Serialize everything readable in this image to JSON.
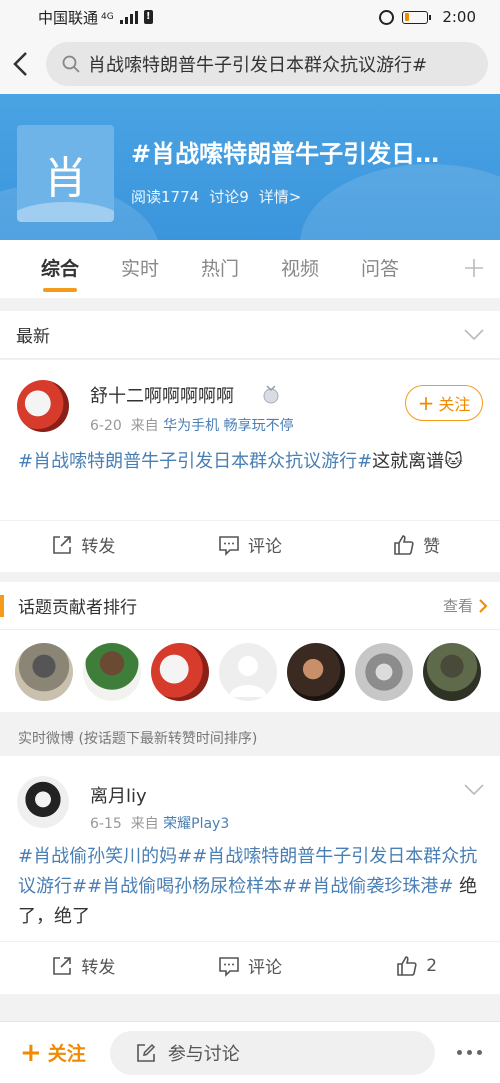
{
  "status_bar": {
    "carrier": "中国联通",
    "network": "4G",
    "time": "2:00"
  },
  "search": {
    "query": "肖战嗦特朗普牛子引发日本群众抗议游行#"
  },
  "topic": {
    "thumb_char": "肖",
    "title": "#肖战嗦特朗普牛子引发日…",
    "reads": "阅读1774",
    "discussions": "讨论9",
    "details": "详情>"
  },
  "tabs": [
    "综合",
    "实时",
    "热门",
    "视频",
    "问答"
  ],
  "latest_section": {
    "title": "最新"
  },
  "post1": {
    "username": "舒十二啊啊啊啊啊",
    "date": "6-20",
    "from": "来自",
    "source": "华为手机 畅享玩不停",
    "follow_label": "关注",
    "hashtag": "#肖战嗦特朗普牛子引发日本群众抗议游行#",
    "text": "这就离谱",
    "emoji": "🐱",
    "actions": {
      "repost": "转发",
      "comment": "评论",
      "like": "赞"
    }
  },
  "contributors": {
    "title": "话题贡献者排行",
    "more": "查看",
    "avatars": [
      "avatar-1",
      "avatar-2",
      "avatar-3",
      "avatar-4",
      "avatar-5",
      "avatar-6",
      "avatar-7"
    ]
  },
  "realtime_label": "实时微博 (按话题下最新转赞时间排序)",
  "post2": {
    "username": "离月liy",
    "date": "6-15",
    "from": "来自",
    "source": "荣耀Play3",
    "hashtags": "#肖战偷孙笑川的妈##肖战嗦特朗普牛子引发日本群众抗议游行##肖战偷喝孙杨尿检样本##肖战偷袭珍珠港#",
    "text": " 绝了，绝了",
    "actions": {
      "repost": "转发",
      "comment": "评论",
      "like": "2"
    }
  },
  "bottom_bar": {
    "follow": "关注",
    "discuss": "参与讨论"
  },
  "colors": {
    "accent": "#f59b1a",
    "link": "#4a7fb5",
    "hero": "#3b95dc"
  }
}
